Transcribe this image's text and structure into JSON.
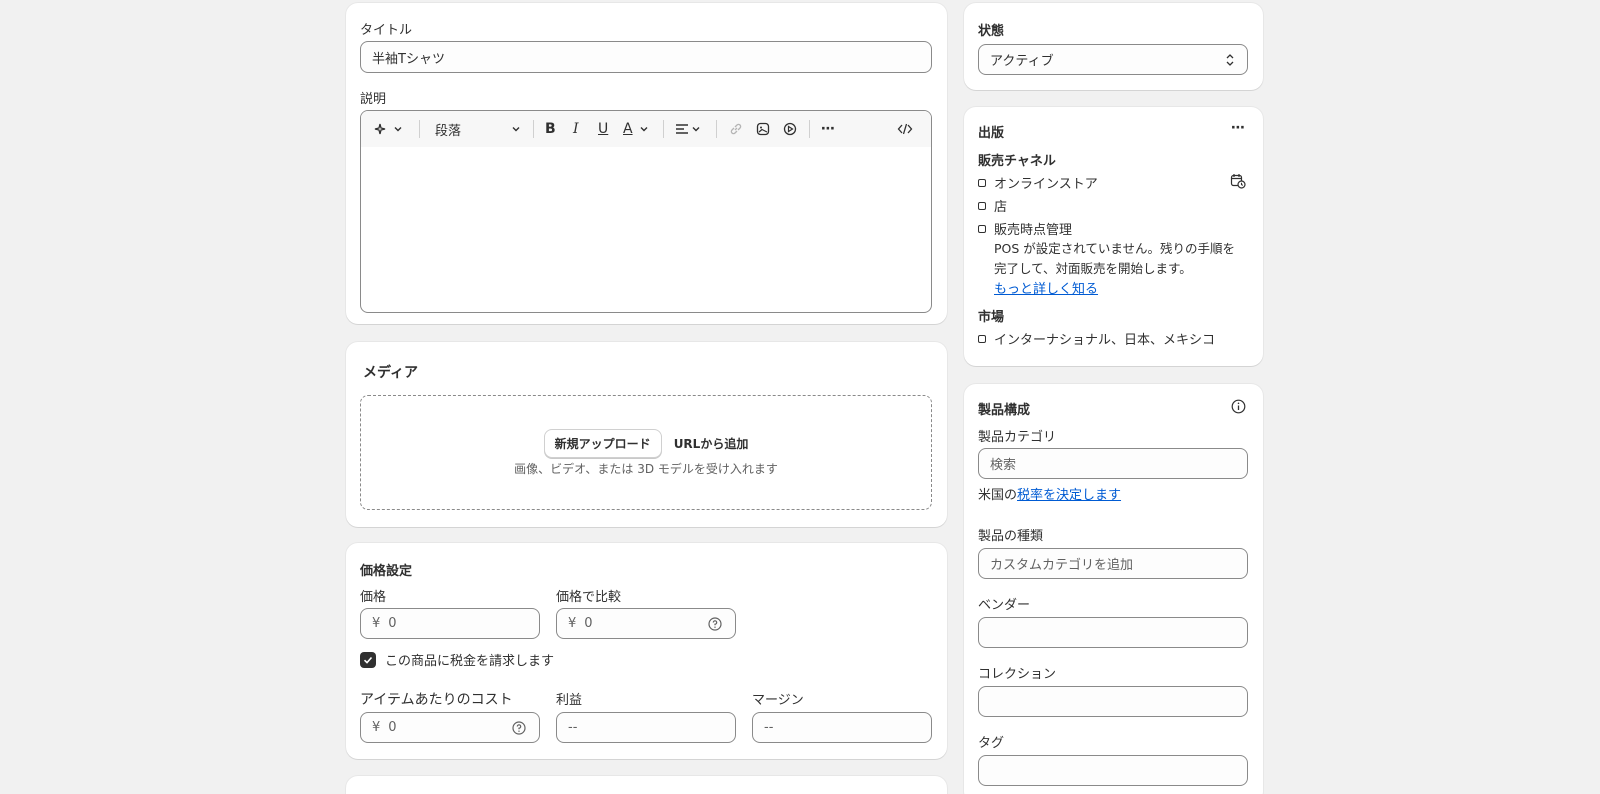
{
  "product": {
    "title_label": "タイトル",
    "title_value": "半袖Tシャツ",
    "description_label": "説明",
    "toolbar": {
      "paragraph_label": "段落"
    }
  },
  "media": {
    "heading": "メディア",
    "upload_button": "新規アップロード",
    "url_button": "URLから追加",
    "hint": "画像、ビデオ、または 3D モデルを受け入れます"
  },
  "pricing": {
    "heading": "価格設定",
    "price_label": "価格",
    "price_currency": "¥",
    "price_value": "0",
    "compare_label": "価格で比較",
    "compare_currency": "¥",
    "compare_value": "0",
    "tax_checkbox_label": "この商品に税金を請求します",
    "tax_checked": true,
    "cost_label": "アイテムあたりのコスト",
    "cost_currency": "¥",
    "cost_value": "0",
    "profit_label": "利益",
    "profit_value": "--",
    "margin_label": "マージン",
    "margin_value": "--"
  },
  "status": {
    "heading": "状態",
    "value": "アクティブ"
  },
  "publishing": {
    "heading": "出版",
    "channels_heading": "販売チャネル",
    "channels": [
      {
        "label": "オンラインストア"
      },
      {
        "label": "店"
      },
      {
        "label": "販売時点管理"
      }
    ],
    "pos_note_line1": "POS が設定されていません。残りの手順を",
    "pos_note_line2": "完了して、対面販売を開始します。",
    "learn_more": "もっと詳しく知る",
    "markets_heading": "市場",
    "markets_value": "インターナショナル、日本、メキシコ"
  },
  "organization": {
    "heading": "製品構成",
    "category_label": "製品カテゴリ",
    "category_placeholder": "検索",
    "tax_prefix": "米国の",
    "tax_link": "税率を決定します",
    "type_label": "製品の種類",
    "type_placeholder": "カスタムカテゴリを追加",
    "vendor_label": "ベンダー",
    "collection_label": "コレクション",
    "tags_label": "タグ"
  },
  "colors": {
    "background": "#f1f1f1",
    "card": "#ffffff",
    "link": "#005bd3",
    "text": "#303030"
  }
}
